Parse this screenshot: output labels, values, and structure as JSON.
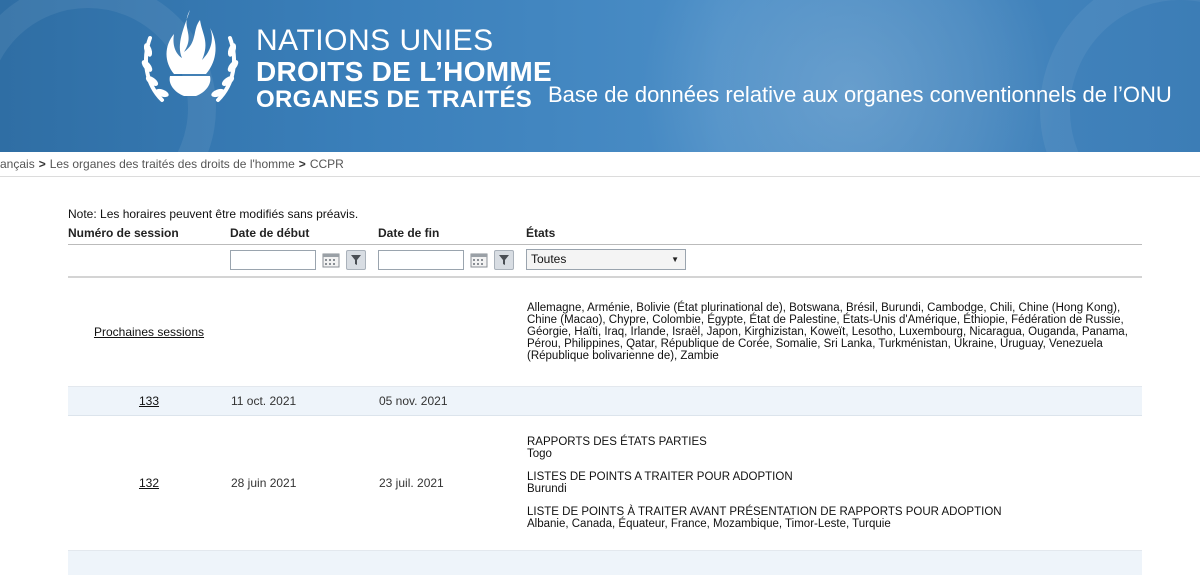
{
  "header": {
    "org_line1": "NATIONS UNIES",
    "org_line2": "DROITS DE L’HOMME",
    "org_line3": "ORGANES DE TRAITÉS",
    "db_title": "Base de données relative aux organes conventionnels de l’ONU"
  },
  "breadcrumb": [
    "ançais",
    "Les organes des traités des droits de l'homme",
    "CCPR"
  ],
  "note": "Note: Les horaires peuvent être modifiés sans préavis.",
  "table": {
    "headers": {
      "session": "Numéro de session",
      "start": "Date de début",
      "end": "Date de fin",
      "states": "États"
    },
    "filters": {
      "start_value": "",
      "end_value": "",
      "states_selected": "Toutes"
    },
    "upcoming": {
      "label": "Prochaines sessions",
      "states": "Allemagne, Arménie, Bolivie (État plurinational de), Botswana, Brésil, Burundi, Cambodge, Chili, Chine (Hong Kong), Chine (Macao), Chypre, Colombie, Égypte, État de Palestine, États-Unis d'Amérique, Éthiopie, Fédération de Russie, Géorgie, Haïti, Iraq, Irlande, Israël, Japon, Kirghizistan, Koweït, Lesotho, Luxembourg, Nicaragua, Ouganda, Panama, Pérou, Philippines, Qatar, République de Corée, Somalie, Sri Lanka, Turkménistan, Ukraine, Uruguay, Venezuela (République bolivarienne de), Zambie"
    },
    "rows": [
      {
        "session": "133",
        "start": "11 oct. 2021",
        "end": "05 nov. 2021",
        "agenda": []
      },
      {
        "session": "132",
        "start": "28 juin 2021",
        "end": "23 juil. 2021",
        "agenda": [
          {
            "title": "RAPPORTS DES ÉTATS PARTIES",
            "states": "Togo"
          },
          {
            "title": "LISTES DE POINTS A TRAITER POUR ADOPTION",
            "states": "Burundi"
          },
          {
            "title": "LISTE DE POINTS À TRAITER AVANT PRÉSENTATION DE RAPPORTS POUR ADOPTION",
            "states": "Albanie, Canada, Équateur, France, Mozambique, Timor-Leste, Turquie"
          }
        ]
      }
    ]
  },
  "icons": {
    "logo": "un-human-rights-emblem-icon",
    "calendar": "calendar-icon",
    "filter": "filter-funnel-icon",
    "dropdown": "chevron-down-icon"
  },
  "colors": {
    "banner": "#3a7fba",
    "row_highlight": "#eef4fa"
  }
}
